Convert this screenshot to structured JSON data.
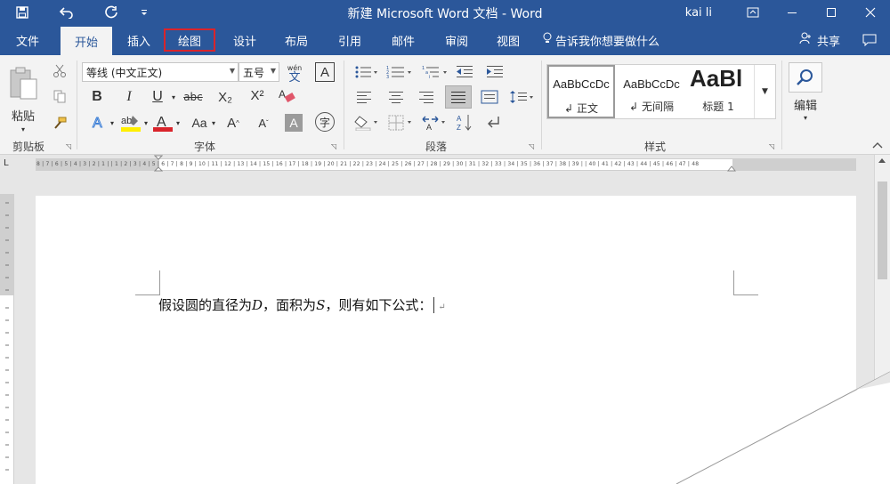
{
  "titlebar": {
    "title": "新建 Microsoft Word 文档  -  Word",
    "user": "kai li",
    "qat": {
      "save_icon": "save-icon",
      "undo_icon": "undo-icon",
      "redo_icon": "redo-icon",
      "customize_icon": "customize-qat-icon"
    }
  },
  "tabs": [
    {
      "label": "文件"
    },
    {
      "label": "开始"
    },
    {
      "label": "插入"
    },
    {
      "label": "绘图"
    },
    {
      "label": "设计"
    },
    {
      "label": "布局"
    },
    {
      "label": "引用"
    },
    {
      "label": "邮件"
    },
    {
      "label": "审阅"
    },
    {
      "label": "视图"
    }
  ],
  "tell_me": "告诉我你想要做什么",
  "share": "共享",
  "ribbon": {
    "clipboard": {
      "label": "剪贴板",
      "paste": "粘贴"
    },
    "font": {
      "label": "字体",
      "font_name": "等线 (中文正文)",
      "font_size": "五号",
      "bold": "B",
      "italic": "I",
      "underline": "U",
      "strike": "abc",
      "sub": "X₂",
      "sup": "X²",
      "change_case": "Aa",
      "grow": "A",
      "shrink": "A",
      "char_shade": "A",
      "enclose": "字",
      "phonetic_top": "wén",
      "phonetic_bottom": "文",
      "border_char": "A"
    },
    "paragraph": {
      "label": "段落"
    },
    "styles": {
      "label": "样式",
      "items": [
        {
          "sample": "AaBbCcDc",
          "name": "正文",
          "mark": "↲"
        },
        {
          "sample": "AaBbCcDc",
          "name": "无间隔",
          "mark": "↲"
        },
        {
          "sample": "AaBl",
          "name": "标题 1"
        }
      ]
    },
    "editing": {
      "label": "编辑"
    }
  },
  "ruler": {
    "numbers": "8 | 7 | 6 | 5 | 4 | 3 | 2 | 1 |    | 1 | 2 | 3 | 4 | 5 | 6 | 7 | 8 | 9 | 10 | 11 | 12 | 13 | 14 | 15 | 16 | 17 | 18 | 19 | 20 | 21 | 22 | 23 | 24 | 25 | 26 | 27 | 28 | 29 | 30 | 31 | 32 | 33 | 34 | 35 | 36 | 37 | 38 | 39 |    | 40 | 41 | 42 | 43 | 44 | 45 | 46 | 47 | 48",
    "tab_selector": "L"
  },
  "document": {
    "seg1": "假设圆的直径为",
    "var_d": "D",
    "seg2": "，面积为",
    "var_s": "S",
    "seg3": "，则有如下公式：",
    "para_mark": "↵"
  },
  "colors": {
    "brand": "#2b579a",
    "highlight_box": "#d9242b",
    "font_color": "#d9242b",
    "highlight_color": "#ffef00"
  }
}
